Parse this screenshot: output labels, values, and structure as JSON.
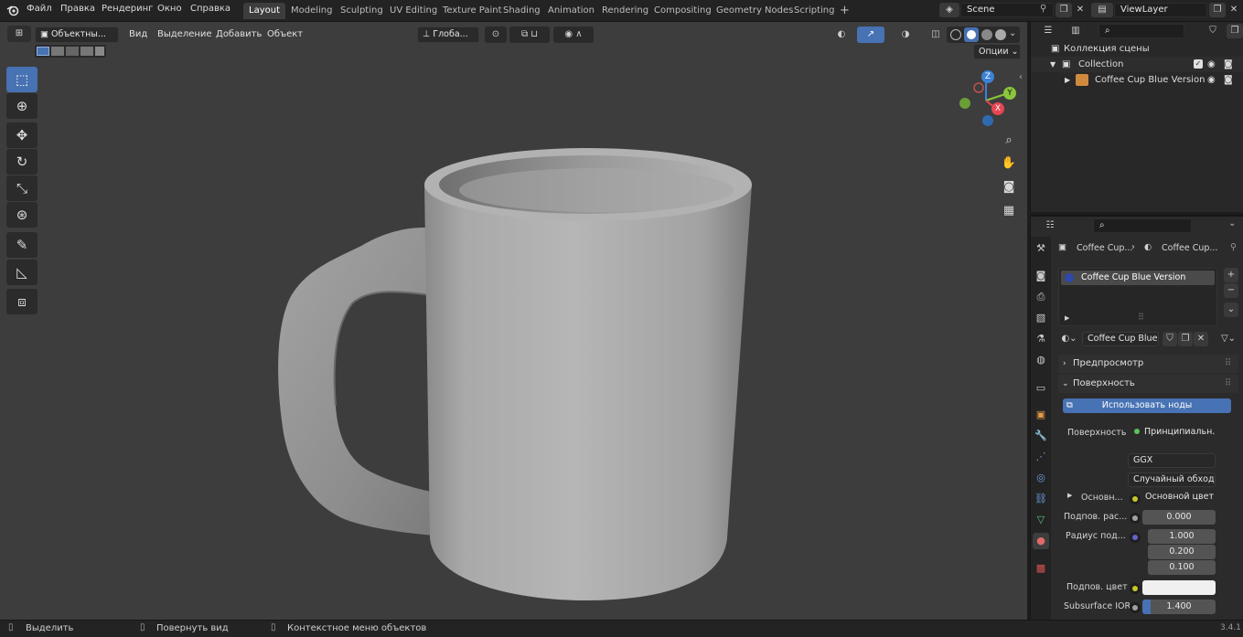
{
  "topbar": {
    "menus": [
      "Файл",
      "Правка",
      "Рендеринг",
      "Окно",
      "Справка"
    ],
    "workspaces": [
      "Layout",
      "Modeling",
      "Sculpting",
      "UV Editing",
      "Texture Paint",
      "Shading",
      "Animation",
      "Rendering",
      "Compositing",
      "Geometry Nodes",
      "Scripting"
    ],
    "active_workspace": "Layout",
    "add_tab": "+",
    "scene": "Scene",
    "view_layer": "ViewLayer"
  },
  "viewport": {
    "mode": "Объектны...",
    "menu": [
      "Вид",
      "Выделение",
      "Добавить",
      "Объект"
    ],
    "transform_orientation": "Глоба...",
    "options": "Опции",
    "gizmo_axes": {
      "z": "Z",
      "y": "Y",
      "x": "X"
    }
  },
  "outliner": {
    "root": "Коллекция сцены",
    "collection": "Collection",
    "object": "Coffee Cup Blue Version"
  },
  "properties": {
    "breadcrumb_object": "Coffee Cup...",
    "breadcrumb_material": "Coffee Cup...",
    "material_slot": "Coffee Cup Blue Version",
    "material_name": "Coffee Cup Blue ...",
    "preview_panel": "Предпросмотр",
    "surface_panel": "Поверхность",
    "use_nodes": "Использовать ноды",
    "surface_label": "Поверхность",
    "surface_value": "Принципиальн...",
    "distribution": "GGX",
    "subsurface_method": "Случайный обход",
    "base_color_label": "Основн...",
    "base_color_value": "Основной цвет",
    "subsurface_label": "Подпов. рас...",
    "subsurface_value": "0.000",
    "radius_label": "Радиус под...",
    "radius_values": [
      "1.000",
      "0.200",
      "0.100"
    ],
    "subsurface_color_label": "Подпов. цвет",
    "subsurface_ior_label": "Subsurface IOR",
    "subsurface_ior_value": "1.400"
  },
  "statusbar": {
    "select": "Выделить",
    "rotate": "Повернуть вид",
    "context": "Контекстное меню объектов",
    "version": "3.4.1"
  },
  "colors": {
    "accent": "#4772b3",
    "viewport_bg": "#3d3d3d",
    "axis_x": "#e64553",
    "axis_y": "#8ac53b",
    "axis_z": "#3b82d6"
  }
}
